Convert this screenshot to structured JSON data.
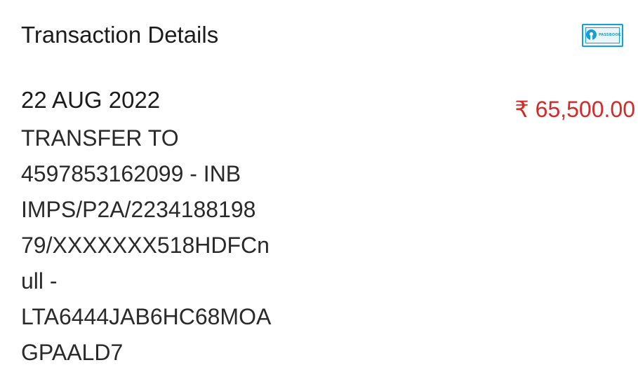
{
  "header": {
    "title": "Transaction Details",
    "passbook_icon": "passbook-icon",
    "passbook_label": "PASSBOOK"
  },
  "transaction": {
    "date": "22 AUG 2022",
    "amount": "₹ 65,500.00",
    "amount_color": "#d32a2a",
    "description_lines": [
      "TRANSFER TO",
      "4597853162099 - INB",
      "IMPS/P2A/2234188198",
      "79/XXXXXXX518HDFCn",
      "ull -",
      "LTA6444JAB6HC68MOA",
      "GPAALD7"
    ]
  }
}
